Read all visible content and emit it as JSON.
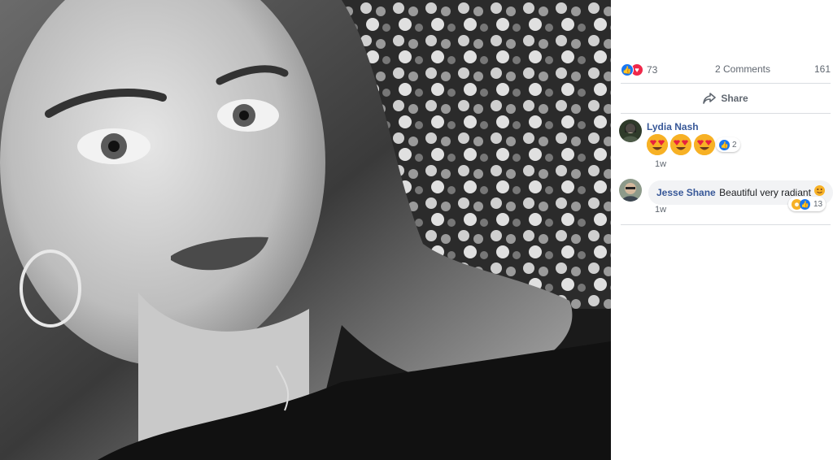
{
  "photo": {
    "description_icon": "portrait-photo"
  },
  "post_stats": {
    "reaction_count": "73",
    "comments_count": "2 Comments",
    "shares_count": "161"
  },
  "actions": {
    "share_label": "Share"
  },
  "comments": [
    {
      "author": "Lydia Nash",
      "text": "",
      "time": "1w",
      "reaction_count": "2",
      "emoji_count": 3
    },
    {
      "author": "Jesse Shane",
      "text": "Beautiful very radiant",
      "time": "1w",
      "reaction_count": "13"
    }
  ],
  "colors": {
    "link": "#385898",
    "like": "#1877f2",
    "love": "#f0284a",
    "emoji": "#f7b125"
  }
}
